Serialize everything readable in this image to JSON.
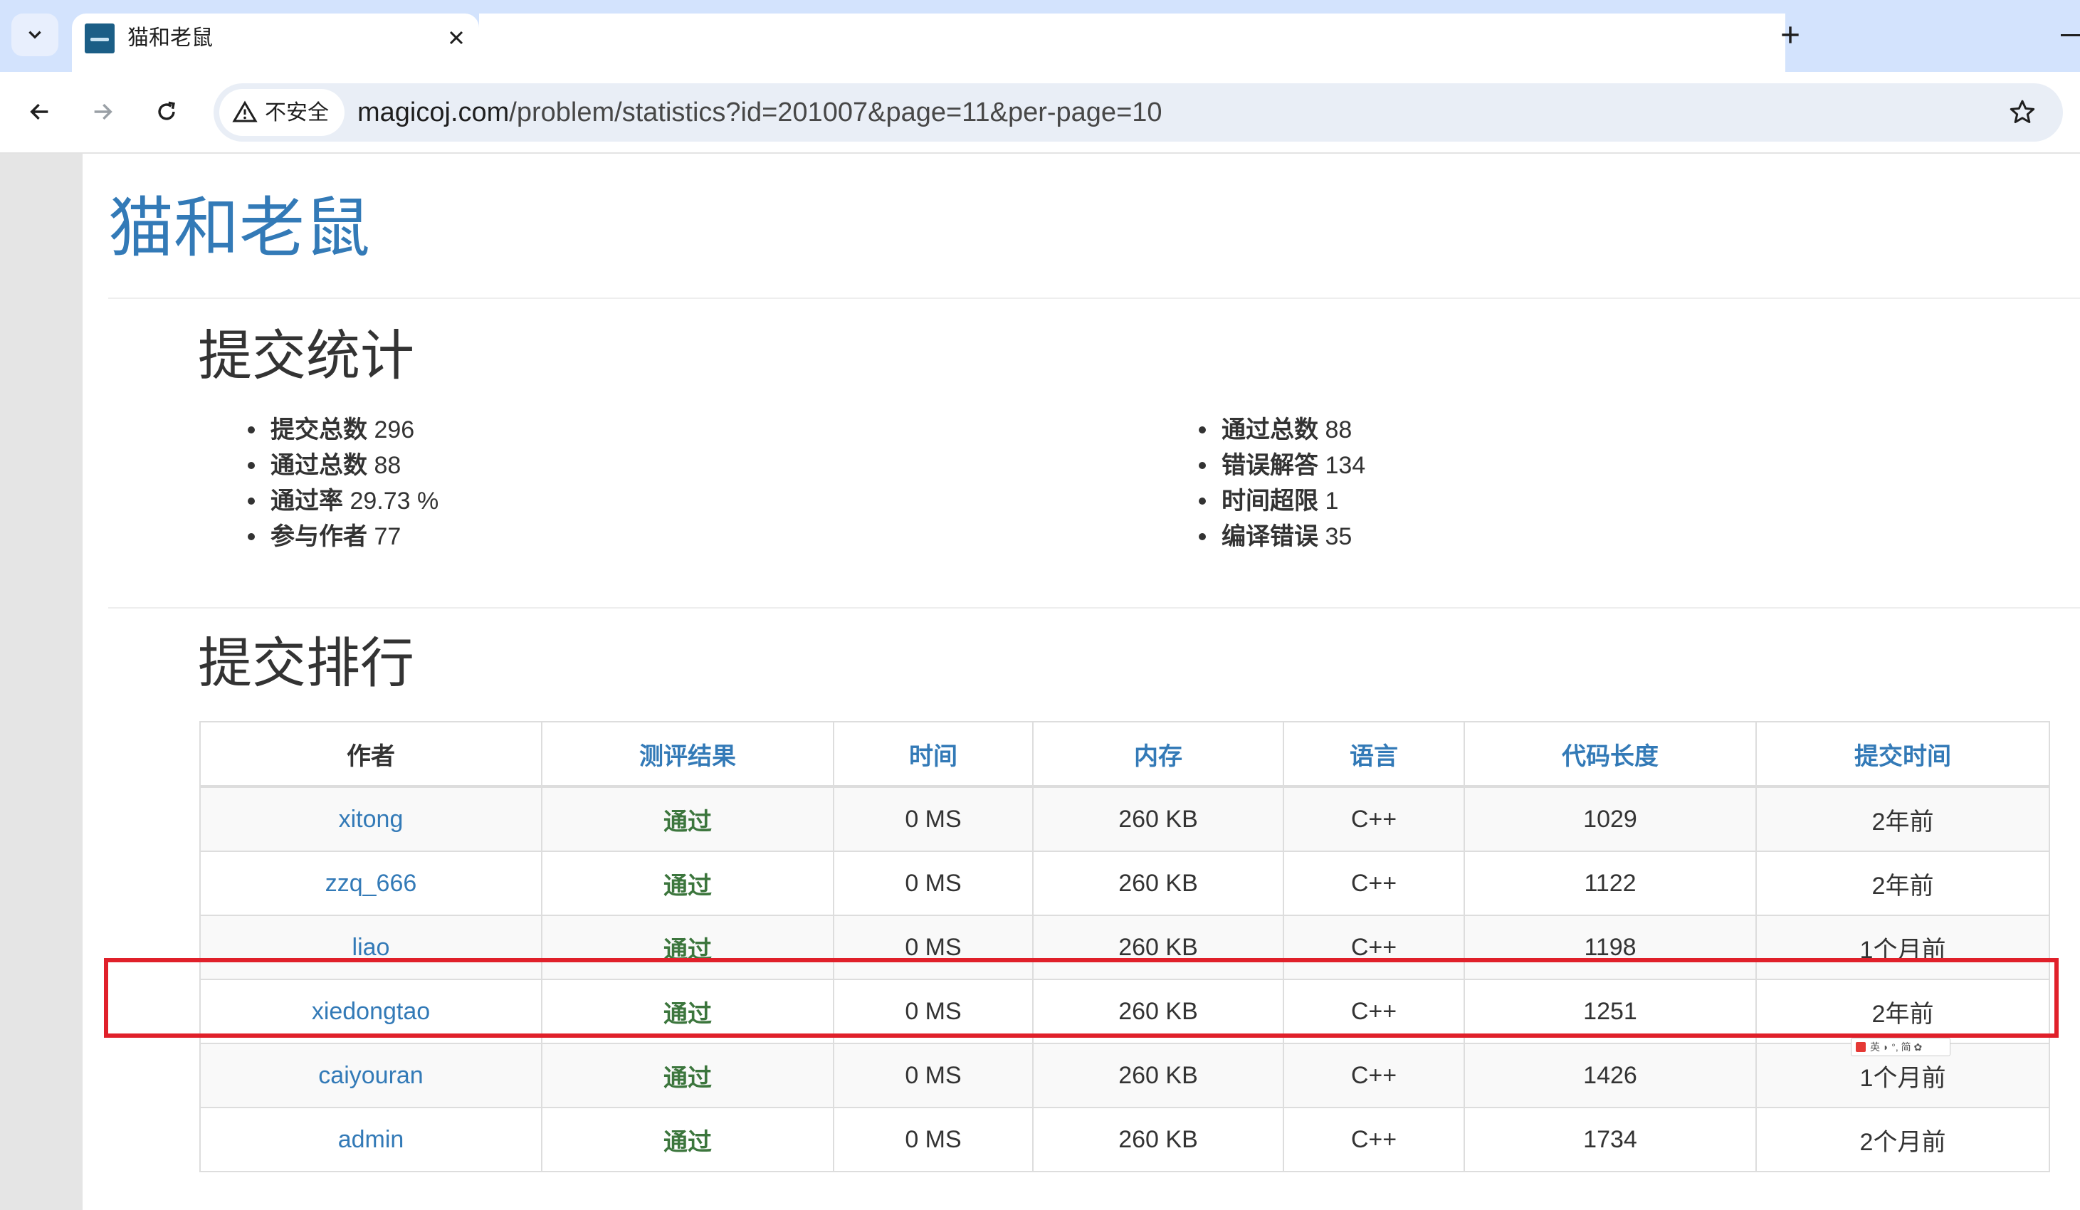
{
  "browser": {
    "tab_title": "猫和老鼠",
    "security_label": "不安全",
    "url_host": "magicoj.com",
    "url_path": "/problem/statistics?id=201007&page=11&per-page=10"
  },
  "page": {
    "problem_title": "猫和老鼠",
    "stats_heading": "提交统计",
    "stats_left": [
      {
        "label": "提交总数",
        "value": "296"
      },
      {
        "label": "通过总数",
        "value": "88"
      },
      {
        "label": "通过率",
        "value": "29.73 %"
      },
      {
        "label": "参与作者",
        "value": "77"
      }
    ],
    "stats_right": [
      {
        "label": "通过总数",
        "value": "88"
      },
      {
        "label": "错误解答",
        "value": "134"
      },
      {
        "label": "时间超限",
        "value": "1"
      },
      {
        "label": "编译错误",
        "value": "35"
      }
    ],
    "ranking_heading": "提交排行",
    "table": {
      "headers": [
        "作者",
        "测评结果",
        "时间",
        "内存",
        "语言",
        "代码长度",
        "提交时间"
      ],
      "rows": [
        [
          "xitong",
          "通过",
          "0 MS",
          "260 KB",
          "C++",
          "1029",
          "2年前"
        ],
        [
          "zzq_666",
          "通过",
          "0 MS",
          "260 KB",
          "C++",
          "1122",
          "2年前"
        ],
        [
          "liao",
          "通过",
          "0 MS",
          "260 KB",
          "C++",
          "1198",
          "1个月前"
        ],
        [
          "xiedongtao",
          "通过",
          "0 MS",
          "260 KB",
          "C++",
          "1251",
          "2年前"
        ],
        [
          "caiyouran",
          "通过",
          "0 MS",
          "260 KB",
          "C++",
          "1426",
          "1个月前"
        ],
        [
          "admin",
          "通过",
          "0 MS",
          "260 KB",
          "C++",
          "1734",
          "2个月前"
        ]
      ]
    },
    "ime_label": "英 ◗ °, 简 ✿"
  },
  "colors": {
    "link": "#337ab7",
    "accepted": "#3c763d",
    "highlight": "#e0202a"
  }
}
